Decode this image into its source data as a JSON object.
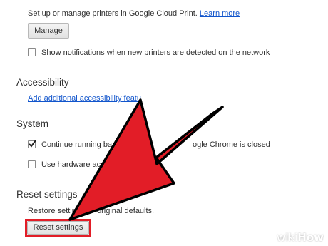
{
  "cloud_print": {
    "description": "Set up or manage printers in Google Cloud Print.",
    "learn_more": "Learn more",
    "manage_button": "Manage",
    "notifications_label": "Show notifications when new printers are detected on the network",
    "notifications_checked": false
  },
  "accessibility": {
    "heading": "Accessibility",
    "link": "Add additional accessibility featu"
  },
  "system": {
    "heading": "System",
    "background_apps_label_start": "Continue running ba",
    "background_apps_label_end": "ogle Chrome is closed",
    "background_apps_checked": true,
    "hardware_accel_label": "Use hardware acce",
    "hardware_accel_checked": false
  },
  "reset": {
    "heading": "Reset settings",
    "description_start": "Restore setting",
    "description_end": "original defaults.",
    "button": "Reset settings"
  },
  "annotation": {
    "arrow_color": "#e21d27",
    "highlight_color": "#e21d27"
  },
  "watermark": {
    "wiki": "wiki",
    "how": "How"
  }
}
